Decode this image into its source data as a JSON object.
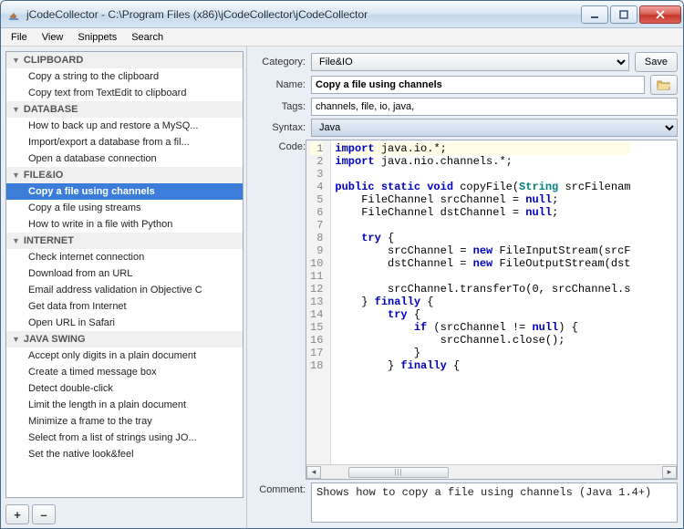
{
  "window": {
    "title": "jCodeCollector - C:\\Program Files (x86)\\jCodeCollector\\jCodeCollector"
  },
  "menu": {
    "file": "File",
    "view": "View",
    "snippets": "Snippets",
    "search": "Search"
  },
  "sidebar": {
    "cats": [
      {
        "name": "CLIPBOARD",
        "items": [
          "Copy a string to the clipboard",
          "Copy text from TextEdit to clipboard"
        ]
      },
      {
        "name": "DATABASE",
        "items": [
          "How to back up and restore a MySQ...",
          "Import/export a database from a fil...",
          "Open a database connection"
        ]
      },
      {
        "name": "FILE&IO",
        "items": [
          "Copy a file using channels",
          "Copy a file using streams",
          "How to write in a file with Python"
        ]
      },
      {
        "name": "INTERNET",
        "items": [
          "Check internet connection",
          "Download from an URL",
          "Email address validation in Objective C",
          "Get data from Internet",
          "Open URL in Safari"
        ]
      },
      {
        "name": "JAVA SWING",
        "items": [
          "Accept only digits in a plain document",
          "Create a timed message box",
          "Detect double-click",
          "Limit the length in a plain document",
          "Minimize a frame to the tray",
          "Select from a list of strings using JO...",
          "Set the native look&feel"
        ]
      }
    ],
    "selected": {
      "cat": 2,
      "item": 0
    },
    "btn_add": "+",
    "btn_remove": "–"
  },
  "labels": {
    "category": "Category:",
    "name": "Name:",
    "tags": "Tags:",
    "syntax": "Syntax:",
    "code": "Code:",
    "comment": "Comment:",
    "save": "Save"
  },
  "fields": {
    "category": "File&IO",
    "name": "Copy a file using channels",
    "tags": "channels, file, io, java,",
    "syntax": "Java",
    "comment": "Shows how to copy a file using channels (Java 1.4+)"
  },
  "code": {
    "lines": [
      {
        "n": 1,
        "tokens": [
          {
            "t": "import ",
            "c": "kw"
          },
          {
            "t": "java.io.*;",
            "c": "id"
          }
        ]
      },
      {
        "n": 2,
        "tokens": [
          {
            "t": "import ",
            "c": "kw"
          },
          {
            "t": "java.nio.channels.*;",
            "c": "id"
          }
        ]
      },
      {
        "n": 3,
        "tokens": []
      },
      {
        "n": 4,
        "tokens": [
          {
            "t": "public static void ",
            "c": "kw"
          },
          {
            "t": "copyFile(",
            "c": "id"
          },
          {
            "t": "String",
            "c": "ty"
          },
          {
            "t": " srcFilenam",
            "c": "id"
          }
        ]
      },
      {
        "n": 5,
        "tokens": [
          {
            "t": "    FileChannel srcChannel = ",
            "c": "id"
          },
          {
            "t": "null",
            "c": "kw"
          },
          {
            "t": ";",
            "c": "id"
          }
        ]
      },
      {
        "n": 6,
        "tokens": [
          {
            "t": "    FileChannel dstChannel = ",
            "c": "id"
          },
          {
            "t": "null",
            "c": "kw"
          },
          {
            "t": ";",
            "c": "id"
          }
        ]
      },
      {
        "n": 7,
        "tokens": []
      },
      {
        "n": 8,
        "tokens": [
          {
            "t": "    try",
            "c": "kw"
          },
          {
            "t": " {",
            "c": "id"
          }
        ]
      },
      {
        "n": 9,
        "tokens": [
          {
            "t": "        srcChannel = ",
            "c": "id"
          },
          {
            "t": "new ",
            "c": "kw"
          },
          {
            "t": "FileInputStream(srcF",
            "c": "id"
          }
        ]
      },
      {
        "n": 10,
        "tokens": [
          {
            "t": "        dstChannel = ",
            "c": "id"
          },
          {
            "t": "new ",
            "c": "kw"
          },
          {
            "t": "FileOutputStream(dst",
            "c": "id"
          }
        ]
      },
      {
        "n": 11,
        "tokens": []
      },
      {
        "n": 12,
        "tokens": [
          {
            "t": "        srcChannel.transferTo(0, srcChannel.s",
            "c": "id"
          }
        ]
      },
      {
        "n": 13,
        "tokens": [
          {
            "t": "    } ",
            "c": "id"
          },
          {
            "t": "finally",
            "c": "kw"
          },
          {
            "t": " {",
            "c": "id"
          }
        ]
      },
      {
        "n": 14,
        "tokens": [
          {
            "t": "        try",
            "c": "kw"
          },
          {
            "t": " {",
            "c": "id"
          }
        ]
      },
      {
        "n": 15,
        "tokens": [
          {
            "t": "            if",
            "c": "kw"
          },
          {
            "t": " (srcChannel != ",
            "c": "id"
          },
          {
            "t": "null",
            "c": "kw"
          },
          {
            "t": ") {",
            "c": "id"
          }
        ]
      },
      {
        "n": 16,
        "tokens": [
          {
            "t": "                srcChannel.close();",
            "c": "id"
          }
        ]
      },
      {
        "n": 17,
        "tokens": [
          {
            "t": "            }",
            "c": "id"
          }
        ]
      },
      {
        "n": 18,
        "tokens": [
          {
            "t": "        } ",
            "c": "id"
          },
          {
            "t": "finally",
            "c": "kw"
          },
          {
            "t": " {",
            "c": "id"
          }
        ]
      }
    ]
  }
}
